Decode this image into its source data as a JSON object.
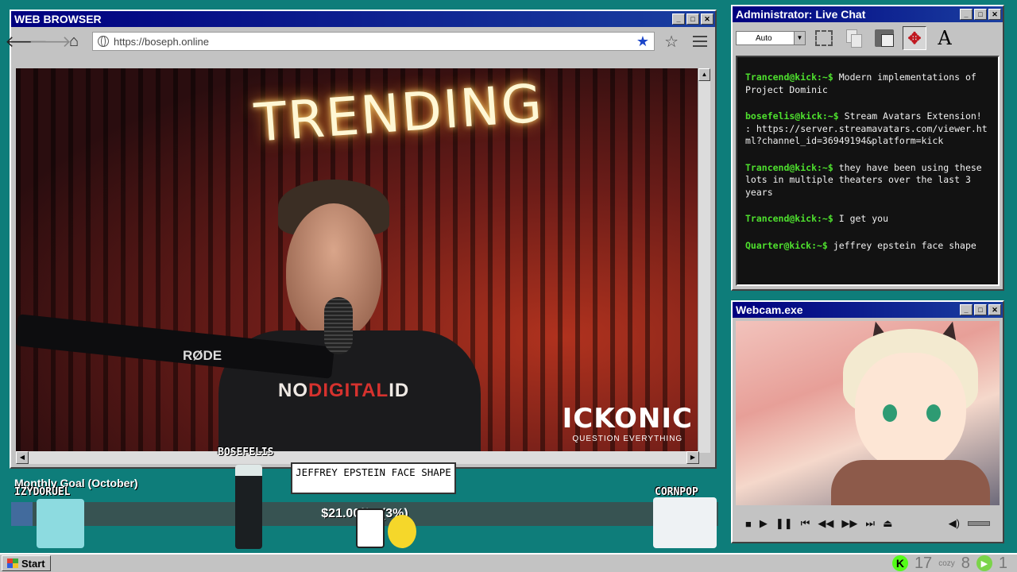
{
  "browser": {
    "title": "WEB BROWSER",
    "url": "https://boseph.online",
    "video": {
      "neon_sign": "TRENDING",
      "shirt_text_a": "NO",
      "shirt_text_b": "DIGITAL",
      "shirt_text_c": "ID",
      "mic_brand": "RØDE",
      "watermark": "ICKONIC",
      "watermark_tagline": "QUESTION EVERYTHING"
    }
  },
  "chat": {
    "title": "Administrator: Live Chat",
    "dropdown_value": "Auto",
    "messages": [
      {
        "user": "Trancend@kick:~$",
        "text": "Modern implementations of Project Dominic"
      },
      {
        "user": "bosefelis@kick:~$",
        "text": "Stream Avatars Extension! : https://server.streamavatars.com/viewer.html?channel_id=36949194&platform=kick"
      },
      {
        "user": "Trancend@kick:~$",
        "text": "they have been using these lots in multiple theaters over the last 3 years"
      },
      {
        "user": "Trancend@kick:~$",
        "text": "I get you"
      },
      {
        "user": "Quarter@kick:~$",
        "text": "jeffrey epstein face shape"
      }
    ]
  },
  "webcam": {
    "title": "Webcam.exe"
  },
  "overlay": {
    "goal_title": "Monthly Goal (October)",
    "goal_amount": "$21.00/$7",
    "goal_percent": "(3%)",
    "goal_fraction": 0.03,
    "names": {
      "avatar_1": "BOSEFELIS",
      "avatar_2": "IZYDORUEL",
      "avatar_3": "CORNPOP"
    },
    "speech_bubble": "JEFFREY EPSTEIN FACE SHAPE"
  },
  "taskbar": {
    "start_label": "Start",
    "tray_count_1": "17",
    "tray_cozy": "cozy",
    "tray_count_2": "8",
    "tray_count_3": "1"
  },
  "colors": {
    "desktop": "#0e7d7a",
    "titlebar": "#00007f",
    "chat_username": "#4ee02e",
    "kick_green": "#53fc18"
  }
}
